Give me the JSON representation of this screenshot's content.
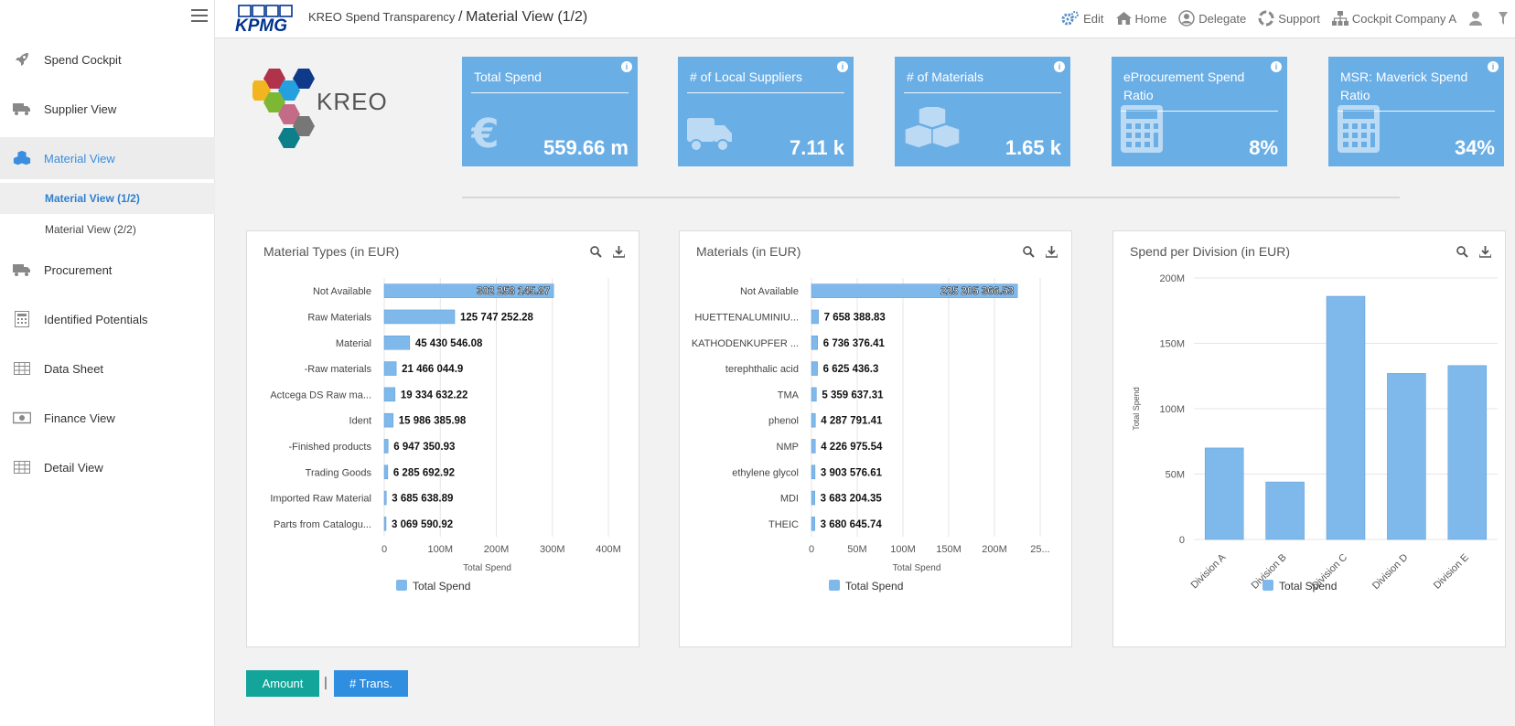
{
  "header": {
    "brand": "KPMG",
    "app_title": "KREO Spend Transparency",
    "separator": "/",
    "page_title": "Material View (1/2)",
    "links": [
      {
        "label": "Edit",
        "icon": "gears-icon"
      },
      {
        "label": "Home",
        "icon": "home-icon"
      },
      {
        "label": "Delegate",
        "icon": "user-circle-icon"
      },
      {
        "label": "Support",
        "icon": "lifebuoy-icon"
      },
      {
        "label": "Cockpit Company A",
        "icon": "sitemap-icon"
      },
      {
        "label": "",
        "icon": "user-icon"
      }
    ]
  },
  "sidebar": {
    "items": [
      {
        "label": "Spend Cockpit",
        "icon": "rocket-icon"
      },
      {
        "label": "Supplier View",
        "icon": "truck-icon"
      },
      {
        "label": "Material View",
        "icon": "cubes-icon",
        "active": true
      },
      {
        "label": "Procurement",
        "icon": "truck-icon"
      },
      {
        "label": "Identified Potentials",
        "icon": "calculator-icon"
      },
      {
        "label": "Data Sheet",
        "icon": "table-icon"
      },
      {
        "label": "Finance View",
        "icon": "money-icon"
      },
      {
        "label": "Detail View",
        "icon": "table-icon"
      }
    ],
    "subitems": [
      {
        "label": "Material View (1/2)",
        "active": true
      },
      {
        "label": "Material View (2/2)"
      }
    ]
  },
  "logo_text": "KREO",
  "kpis": [
    {
      "title": "Total Spend",
      "value": "559.66 m",
      "icon": "euro-icon"
    },
    {
      "title": "# of Local Suppliers",
      "value": "7.11 k",
      "icon": "truck-icon"
    },
    {
      "title": "# of Materials",
      "value": "1.65 k",
      "icon": "cubes-icon"
    },
    {
      "title": "eProcurement Spend Ratio",
      "value": "8%",
      "icon": "calculator-icon"
    },
    {
      "title": "MSR: Maverick Spend Ratio",
      "value": "34%",
      "icon": "calculator-icon"
    }
  ],
  "buttons": {
    "amount": "Amount",
    "separator": "|",
    "trans": "# Trans."
  },
  "chart_data": [
    {
      "type": "bar",
      "orientation": "horizontal",
      "title": "Material Types (in EUR)",
      "xlabel": "Total Spend",
      "xlim": [
        0,
        400000000
      ],
      "ticks": [
        "0",
        "100M",
        "200M",
        "300M",
        "400M"
      ],
      "tick_values": [
        0,
        100000000,
        200000000,
        300000000,
        400000000
      ],
      "categories": [
        "Not Available",
        "Raw Materials",
        "Material",
        "-Raw materials",
        "Actcega DS Raw ma...",
        "Ident",
        "-Finished products",
        "Trading Goods",
        "Imported Raw Material",
        "Parts from Catalogu..."
      ],
      "values": [
        302258145.87,
        125747252.28,
        45430546.08,
        21466044.9,
        19334632.22,
        15986385.98,
        6947350.93,
        6285692.92,
        3685638.89,
        3069590.92
      ],
      "labels": [
        "302 258 145.87",
        "125 747 252.28",
        "45 430 546.08",
        "21 466 044.9",
        "19 334 632.22",
        "15 986 385.98",
        "6 947 350.93",
        "6 285 692.92",
        "3 685 638.89",
        "3 069 590.92"
      ],
      "legend": "Total Spend",
      "color": "#7fb8ea"
    },
    {
      "type": "bar",
      "orientation": "horizontal",
      "title": "Materials (in EUR)",
      "xlabel": "Total Spend",
      "xlim": [
        0,
        250000000
      ],
      "ticks": [
        "0",
        "50M",
        "100M",
        "150M",
        "200M",
        "25..."
      ],
      "tick_values": [
        0,
        50000000,
        100000000,
        150000000,
        200000000,
        250000000
      ],
      "categories": [
        "Not Available",
        "HUETTENALUMINIU...",
        "KATHODENKUPFER ...",
        "terephthalic acid",
        "TMA",
        "phenol",
        "NMP",
        "ethylene glycol",
        "MDI",
        "THEIC"
      ],
      "values": [
        225205366.53,
        7658388.83,
        6736376.41,
        6625436.3,
        5359637.31,
        4287791.41,
        4226975.54,
        3903576.61,
        3683204.35,
        3680645.74
      ],
      "labels": [
        "225 205 366.53",
        "7 658 388.83",
        "6 736 376.41",
        "6 625 436.3",
        "5 359 637.31",
        "4 287 791.41",
        "4 226 975.54",
        "3 903 576.61",
        "3 683 204.35",
        "3 680 645.74"
      ],
      "legend": "Total Spend",
      "color": "#7fb8ea"
    },
    {
      "type": "bar",
      "orientation": "vertical",
      "title": "Spend per Division (in EUR)",
      "ylabel": "Total Spend",
      "ylim": [
        0,
        200000000
      ],
      "ticks": [
        "0",
        "50M",
        "100M",
        "150M",
        "200M"
      ],
      "tick_values": [
        0,
        50000000,
        100000000,
        150000000,
        200000000
      ],
      "categories": [
        "Division A",
        "Division B",
        "Division C",
        "Division D",
        "Division E"
      ],
      "values": [
        70000000,
        44000000,
        186000000,
        127000000,
        133000000
      ],
      "legend": "Total Spend",
      "color": "#7fb8ea"
    }
  ]
}
